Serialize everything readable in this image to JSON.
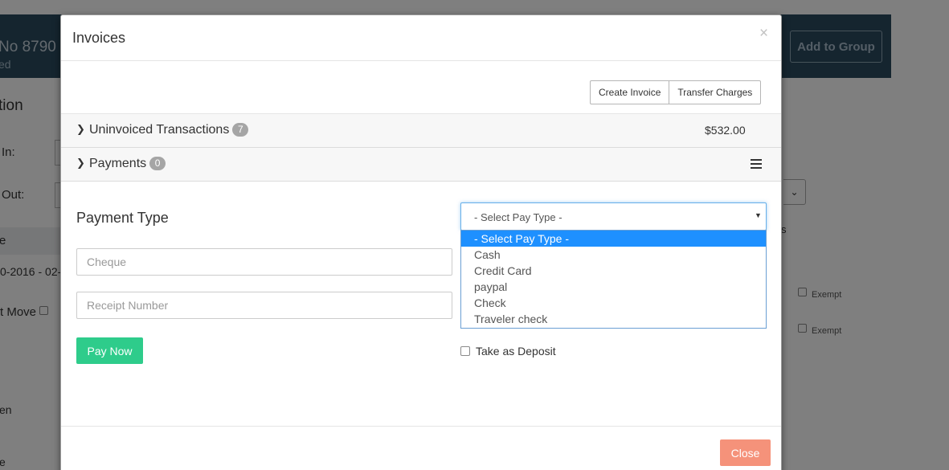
{
  "background": {
    "header_title": "No 8790",
    "header_subtitle": "ed",
    "add_to_group_label": "Add to Group",
    "section_title": "tion",
    "check_in_label": "In:",
    "check_out_label": "Out:",
    "row_letter": "e",
    "date_range": "0-2016 - 02-",
    "move_label": "t Move",
    "exempt_label_1": "Exempt",
    "exempt_label_2": "Exempt",
    "side_letter": "s",
    "bottom_text_1": "en",
    "bottom_text_2": "e",
    "select_arrow": "⌄"
  },
  "modal": {
    "title": "Invoices",
    "close_x": "×",
    "actions": {
      "create_invoice": "Create Invoice",
      "transfer_charges": "Transfer Charges"
    },
    "accordion": {
      "uninvoiced": {
        "label": "Uninvoiced Transactions",
        "count": "7",
        "amount": "$532.00"
      },
      "payments": {
        "label": "Payments",
        "count": "0"
      }
    },
    "form": {
      "payment_type_label": "Payment Type",
      "pay_type_select": {
        "value": "- Select Pay Type -",
        "options": [
          "- Select Pay Type -",
          "Cash",
          "Credit Card",
          "paypal",
          "Check",
          "Traveler check"
        ],
        "selected_index": 0
      },
      "cheque_placeholder": "Cheque",
      "receipt_placeholder": "Receipt Number",
      "pay_now_label": "Pay Now",
      "take_as_deposit_label": "Take as Deposit",
      "take_as_deposit_checked": false
    },
    "footer": {
      "close_label": "Close"
    }
  },
  "colors": {
    "pay_now": "#2ecc8b",
    "close": "#f5927a",
    "dropdown_highlight": "#1e90ff",
    "badge": "#a5a5a5"
  }
}
